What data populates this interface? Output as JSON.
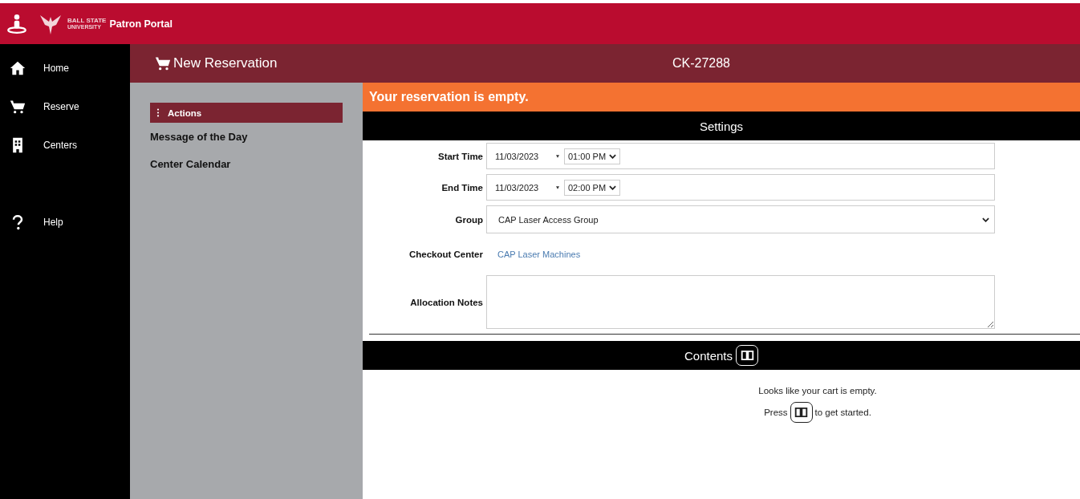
{
  "header": {
    "logo_line_1": "BALL STATE",
    "logo_line_2": "UNIVERSITY",
    "title": "Patron Portal"
  },
  "nav": [
    {
      "label": "Home"
    },
    {
      "label": "Reserve"
    },
    {
      "label": "Centers"
    },
    {
      "label": "Help"
    }
  ],
  "page_title": "New Reservation",
  "reservation_id": "CK-27288",
  "side_panel": {
    "actions": "Actions",
    "links": [
      "Message of the Day",
      "Center Calendar"
    ]
  },
  "alert": "Your reservation is empty.",
  "settings": {
    "title": "Settings",
    "rows": [
      {
        "kind": "datetime",
        "label": "Start Time",
        "date": "11/03/2023",
        "time": "01:00 PM"
      },
      {
        "kind": "datetime",
        "label": "End Time",
        "date": "11/03/2023",
        "time": "02:00 PM"
      },
      {
        "kind": "select",
        "label": "Group",
        "value": "CAP Laser Access Group"
      },
      {
        "kind": "link",
        "label": "Checkout Center",
        "value": "CAP Laser Machines"
      },
      {
        "kind": "textarea",
        "label": "Allocation Notes"
      }
    ]
  },
  "contents": {
    "title": "Contents",
    "empty_message": "Looks like your cart is empty.",
    "press": "Press",
    "get_started": "to get started."
  }
}
